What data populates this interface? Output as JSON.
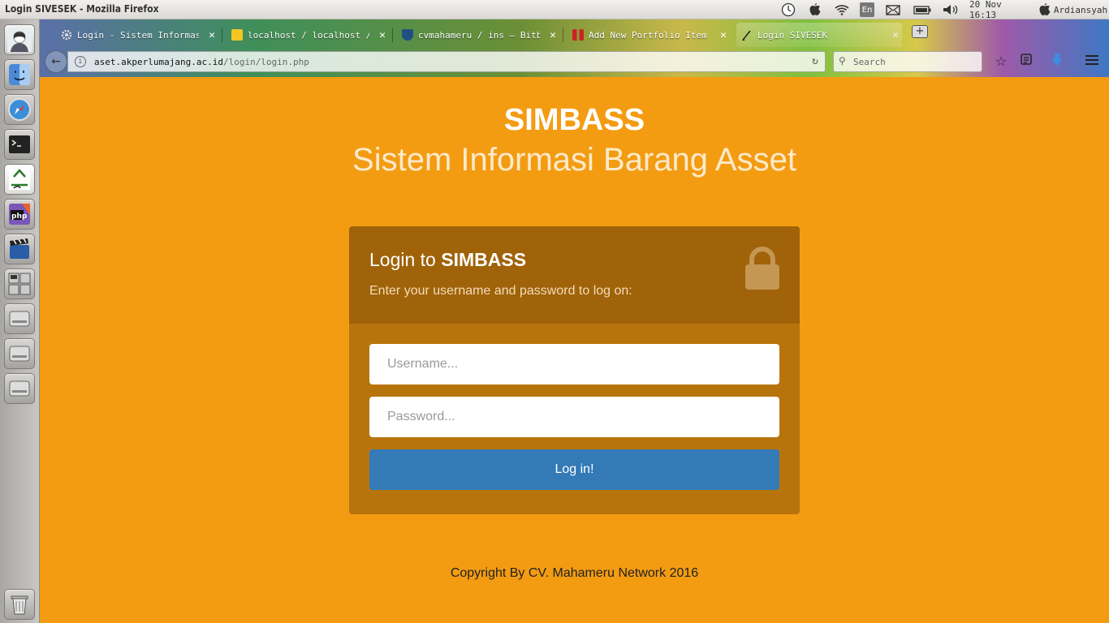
{
  "system_bar": {
    "window_title": "Login SIVESEK - Mozilla Firefox",
    "keyboard_layout": "En",
    "datetime": "20 Nov 16:13",
    "user": "Ardiansyah"
  },
  "browser": {
    "tabs": [
      {
        "label": "Login - Sistem Informasi…",
        "favicon": "gear-icon"
      },
      {
        "label": "localhost / localhost / …",
        "favicon": "phpmyadmin-icon"
      },
      {
        "label": "cvmahameru / ins — Bitbu…",
        "favicon": "bitbucket-icon"
      },
      {
        "label": "Add New Portfolio Item ‹…",
        "favicon": "wordpress-icon"
      },
      {
        "label": "Login SIVESEK",
        "favicon": "pen-icon",
        "active": true
      }
    ],
    "url_host": "aset.akperlumajang.ac.id",
    "url_path": "/login/login.php",
    "search_placeholder": "Search"
  },
  "page": {
    "brand": "SIMBASS",
    "subtitle": "Sistem Informasi Barang Asset",
    "login": {
      "title_prefix": "Login to",
      "title_brand": "SIMBASS",
      "hint": "Enter your username and password to log on:",
      "username_placeholder": "Username...",
      "password_placeholder": "Password...",
      "submit_label": "Log in!"
    },
    "copyright": "Copyright By CV. Mahameru Network 2016"
  },
  "colors": {
    "page_background": "#f39c12",
    "login_header": "#a0630a",
    "login_body": "#b8740c",
    "button_primary": "#337ab7"
  }
}
